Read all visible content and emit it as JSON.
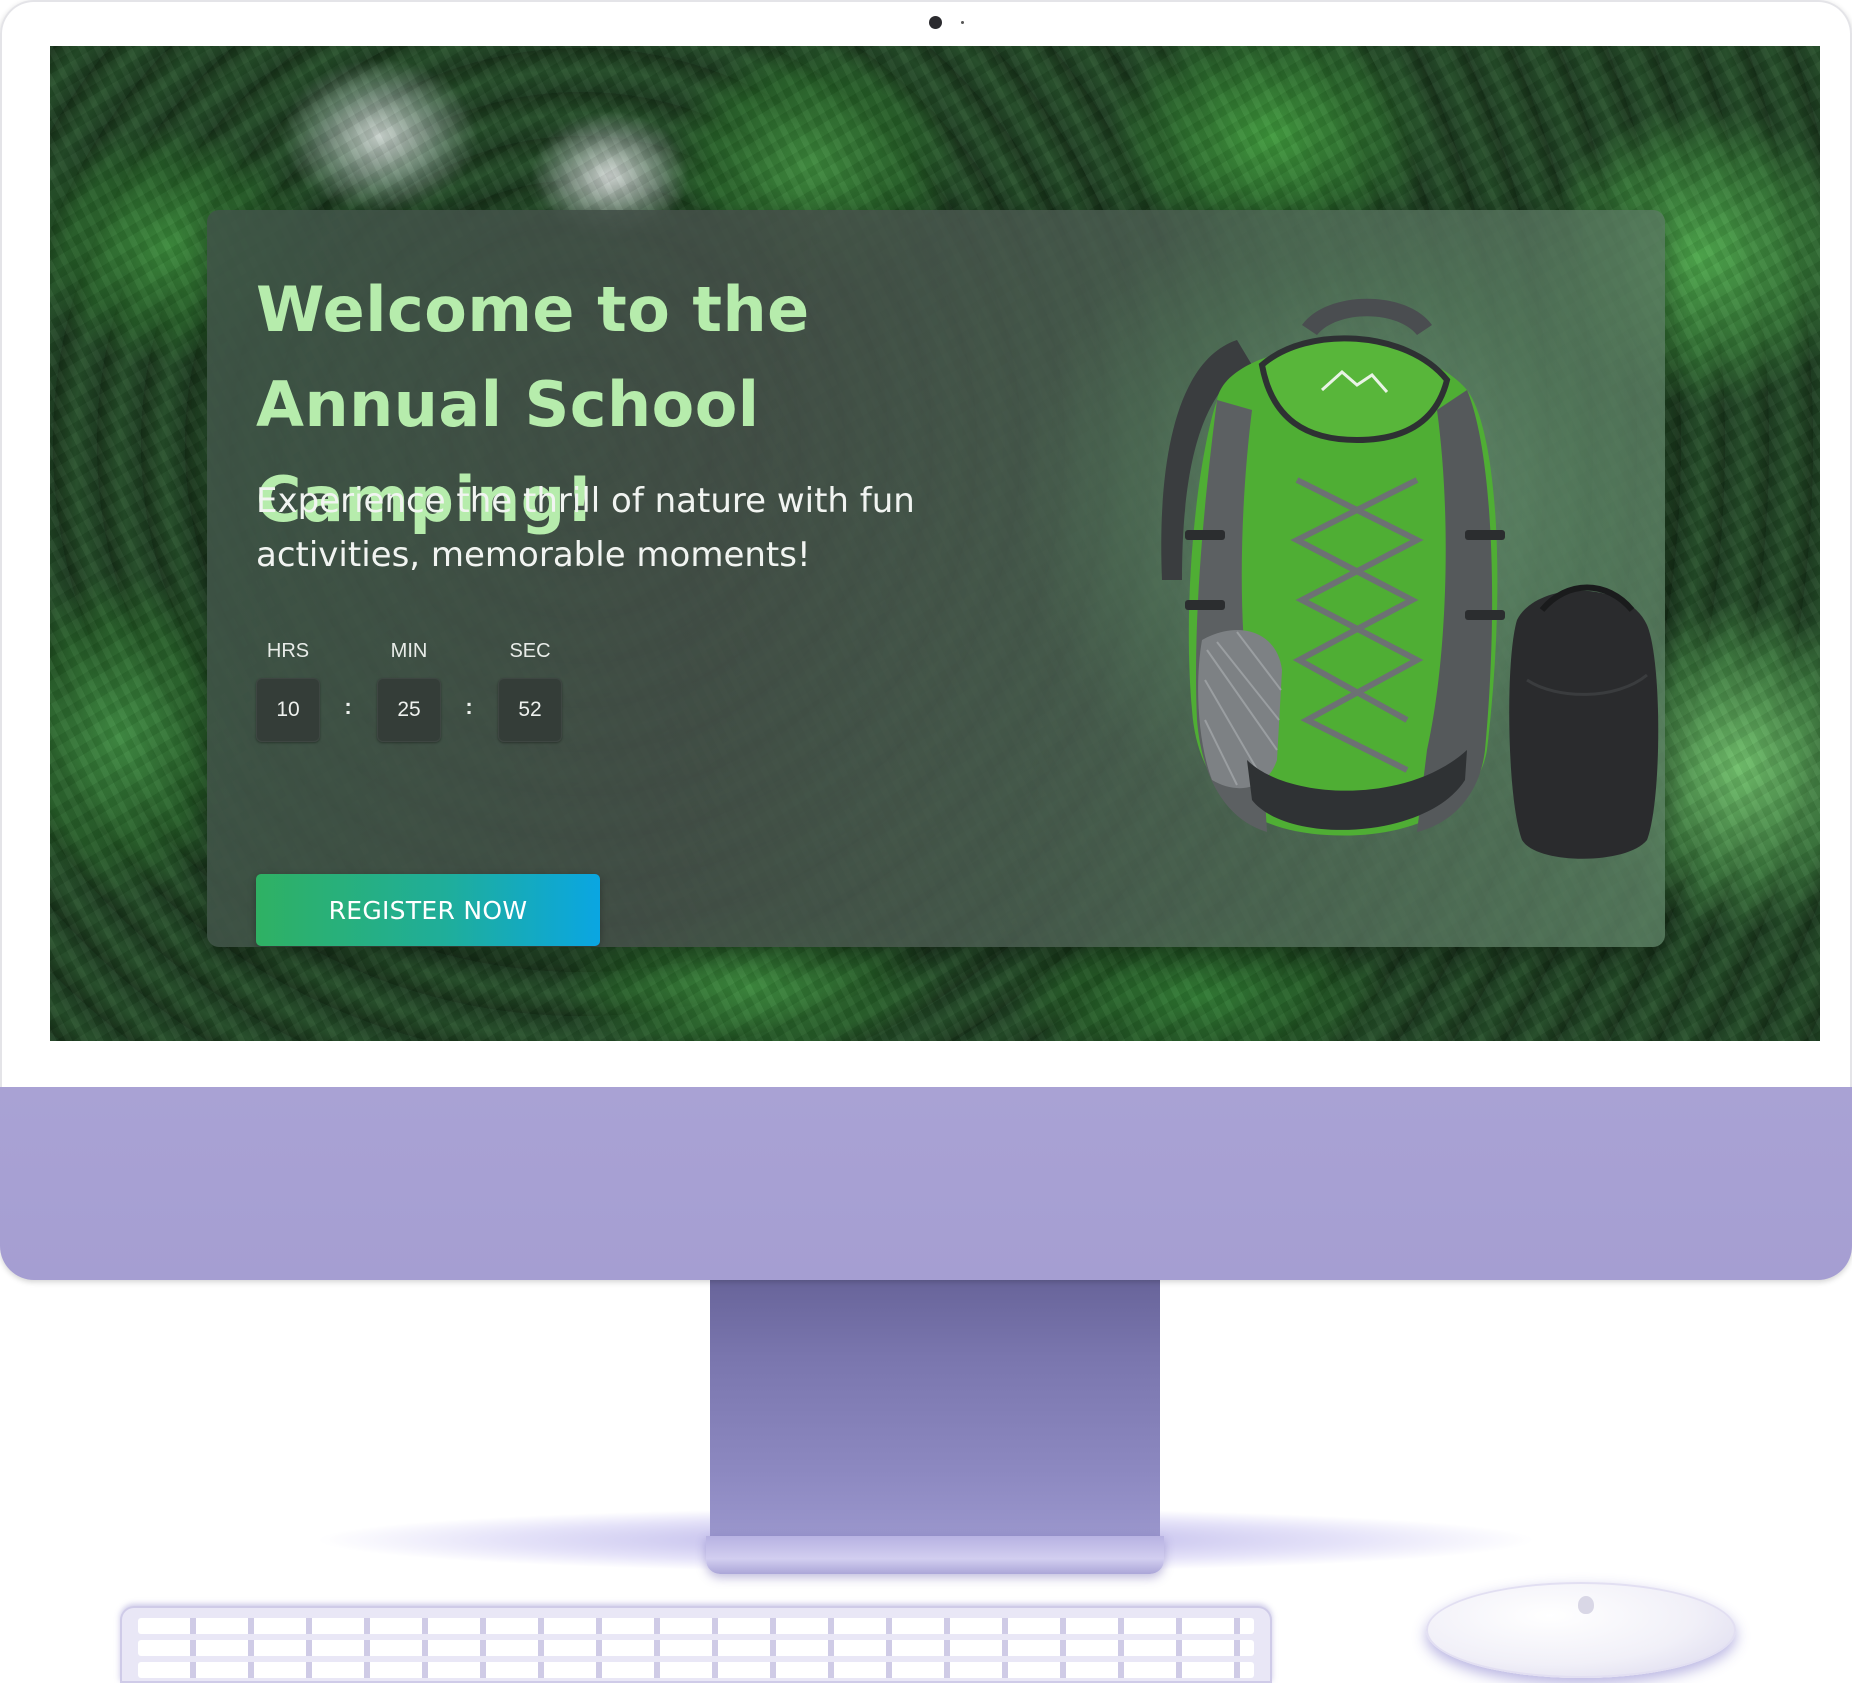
{
  "hero": {
    "title": "Welcome to the Annual School Camping!",
    "subtitle": "Experience the thrill of nature with fun activities, memorable moments!"
  },
  "countdown": {
    "hours_label": "HRS",
    "minutes_label": "MIN",
    "seconds_label": "SEC",
    "hours": "10",
    "minutes": "25",
    "seconds": "52",
    "separator": ":"
  },
  "cta": {
    "register_label": "REGISTER NOW"
  },
  "colors": {
    "title": "#b6ecac",
    "button_start": "#2fb163",
    "button_end": "#0aa6e2",
    "device_body": "#a9a2d4"
  },
  "icons": {
    "product": "backpack-illustration",
    "device_logo": "apple-logo-icon"
  }
}
